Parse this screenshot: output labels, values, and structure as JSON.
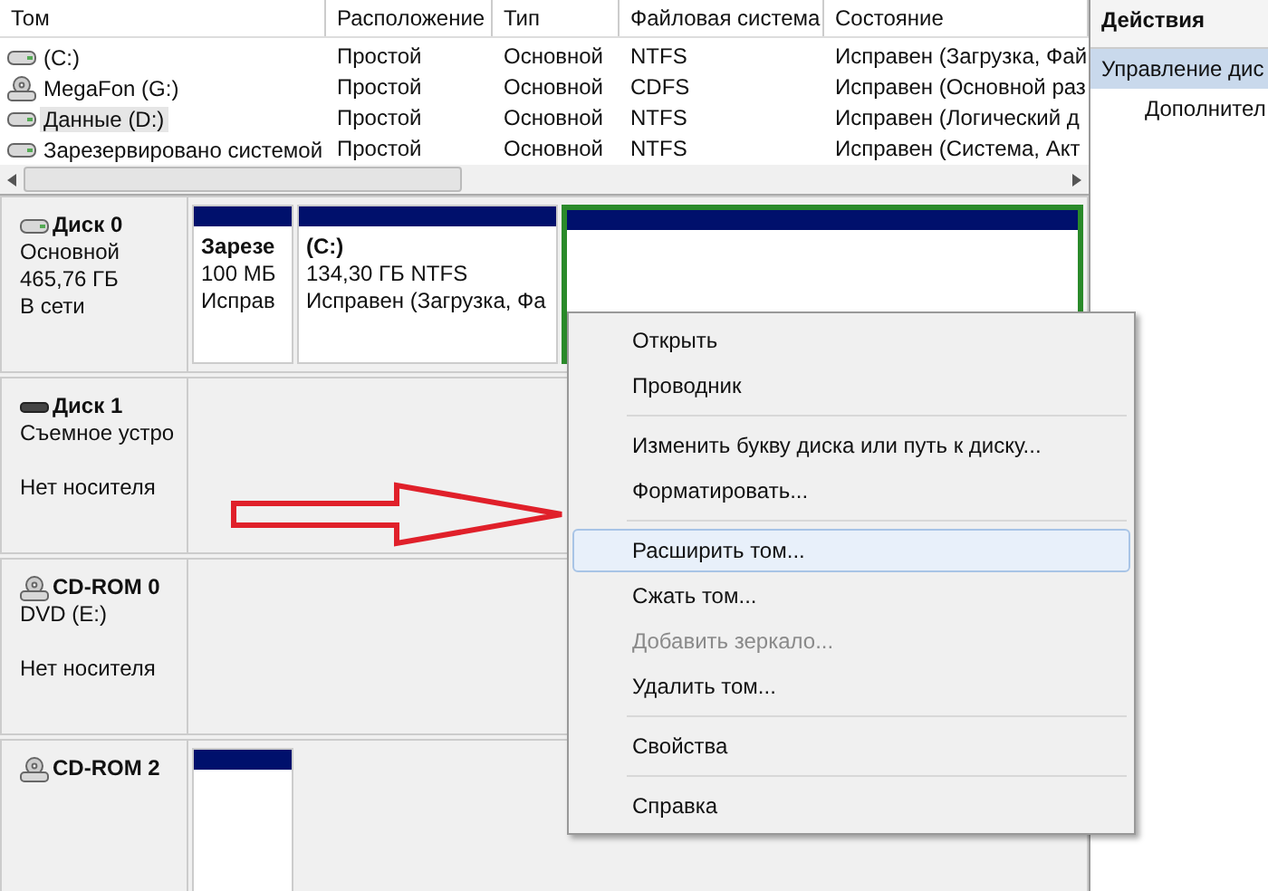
{
  "volumes_table": {
    "columns": [
      "Том",
      "Расположение",
      "Тип",
      "Файловая система",
      "Состояние"
    ],
    "rows": [
      {
        "kind": "hdd",
        "selected": false,
        "cells": [
          "(C:)",
          "Простой",
          "Основной",
          "NTFS",
          "Исправен (Загрузка, Фай"
        ]
      },
      {
        "kind": "cd",
        "selected": false,
        "cells": [
          "MegaFon (G:)",
          "Простой",
          "Основной",
          "CDFS",
          "Исправен (Основной раз"
        ]
      },
      {
        "kind": "hdd",
        "selected": true,
        "cells": [
          "Данные (D:)",
          "Простой",
          "Основной",
          "NTFS",
          "Исправен (Логический д"
        ]
      },
      {
        "kind": "hdd",
        "selected": false,
        "cells": [
          "Зарезервировано системой",
          "Простой",
          "Основной",
          "NTFS",
          "Исправен (Система, Акт"
        ]
      }
    ]
  },
  "actions_panel": {
    "title": "Действия",
    "items": [
      {
        "kind": "group",
        "label": "Управление дис",
        "selected": true
      },
      {
        "kind": "action",
        "label": "Дополнител",
        "selected": false
      }
    ]
  },
  "disks": [
    {
      "kind": "hdd",
      "name": "Диск 0",
      "info": [
        "Основной",
        "465,76 ГБ",
        "В сети"
      ],
      "partitions": [
        {
          "title": "Зарезе",
          "lines": [
            "100 МБ",
            "Исправ"
          ],
          "selected": false
        },
        {
          "title": "(C:)",
          "lines": [
            "134,30 ГБ NTFS",
            "Исправен (Загрузка, Фа"
          ],
          "selected": false
        },
        {
          "selected": true
        }
      ]
    },
    {
      "kind": "removable",
      "name": "Диск 1",
      "info": [
        "Съемное устро"
      ],
      "media": "Нет носителя"
    },
    {
      "kind": "cd",
      "name": "CD-ROM 0",
      "info": [
        "DVD (E:)"
      ],
      "media": "Нет носителя"
    },
    {
      "kind": "cd",
      "name": "CD-ROM 2",
      "partitions": [
        {
          "selected": false
        }
      ]
    }
  ],
  "context_menu": {
    "items": [
      {
        "kind": "item",
        "label": "Открыть",
        "selected": false,
        "disabled": false
      },
      {
        "kind": "item",
        "label": "Проводник",
        "selected": false,
        "disabled": false
      },
      {
        "kind": "separator"
      },
      {
        "kind": "item",
        "label": "Изменить букву диска или путь к диску...",
        "selected": false,
        "disabled": false
      },
      {
        "kind": "item",
        "label": "Форматировать...",
        "selected": false,
        "disabled": false
      },
      {
        "kind": "separator"
      },
      {
        "kind": "item",
        "label": "Расширить том...",
        "selected": true,
        "disabled": false
      },
      {
        "kind": "item",
        "label": "Сжать том...",
        "selected": false,
        "disabled": false
      },
      {
        "kind": "item",
        "label": "Добавить зеркало...",
        "selected": false,
        "disabled": true
      },
      {
        "kind": "item",
        "label": "Удалить том...",
        "selected": false,
        "disabled": false
      },
      {
        "kind": "separator"
      },
      {
        "kind": "item",
        "label": "Свойства",
        "selected": false,
        "disabled": false
      },
      {
        "kind": "separator"
      },
      {
        "kind": "item",
        "label": "Справка",
        "selected": false,
        "disabled": false
      }
    ]
  }
}
